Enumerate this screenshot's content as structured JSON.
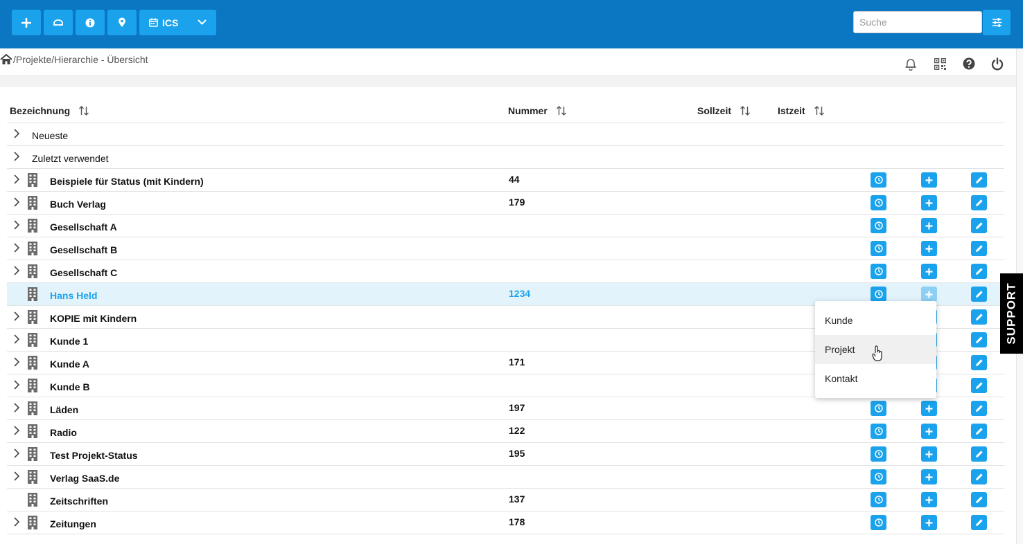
{
  "topbar": {
    "buttons": [
      {
        "name": "add-button",
        "icon": "plus-icon"
      },
      {
        "name": "vehicle-button",
        "icon": "car-icon"
      },
      {
        "name": "info-button",
        "icon": "info-icon"
      },
      {
        "name": "location-button",
        "icon": "map-pin-icon"
      }
    ],
    "ics_label": "ICS",
    "search_placeholder": "Suche",
    "accent_color": "#1aa3ec",
    "bar_color": "#0b77c2"
  },
  "breadcrumb": "/Projekte/Hierarchie - Übersicht",
  "header_icons": [
    "bell-icon",
    "qr-code-icon",
    "help-icon",
    "power-icon"
  ],
  "table": {
    "columns": {
      "bezeichnung": "Bezeichnung",
      "nummer": "Nummer",
      "sollzeit": "Sollzeit",
      "istzeit": "Istzeit"
    },
    "rows": [
      {
        "name": "Neueste",
        "number": "",
        "kind": "group",
        "expandable": true
      },
      {
        "name": "Zuletzt verwendet",
        "number": "",
        "kind": "group",
        "expandable": true
      },
      {
        "name": "Beispiele für Status (mit Kindern)",
        "number": "44",
        "kind": "item",
        "expandable": true
      },
      {
        "name": "Buch Verlag",
        "number": "179",
        "kind": "item",
        "expandable": true
      },
      {
        "name": "Gesellschaft A",
        "number": "",
        "kind": "item",
        "expandable": true
      },
      {
        "name": "Gesellschaft B",
        "number": "",
        "kind": "item",
        "expandable": true
      },
      {
        "name": "Gesellschaft C",
        "number": "",
        "kind": "item",
        "expandable": true
      },
      {
        "name": "Hans Held",
        "number": "1234",
        "kind": "item",
        "expandable": false,
        "highlighted": true
      },
      {
        "name": "KOPIE mit Kindern",
        "number": "",
        "kind": "item",
        "expandable": true
      },
      {
        "name": "Kunde 1",
        "number": "",
        "kind": "item",
        "expandable": true
      },
      {
        "name": "Kunde A",
        "number": "171",
        "kind": "item",
        "expandable": true
      },
      {
        "name": "Kunde B",
        "number": "",
        "kind": "item",
        "expandable": true
      },
      {
        "name": "Läden",
        "number": "197",
        "kind": "item",
        "expandable": true
      },
      {
        "name": "Radio",
        "number": "122",
        "kind": "item",
        "expandable": true
      },
      {
        "name": "Test Projekt-Status",
        "number": "195",
        "kind": "item",
        "expandable": true
      },
      {
        "name": "Verlag SaaS.de",
        "number": "",
        "kind": "item",
        "expandable": true
      },
      {
        "name": "Zeitschriften",
        "number": "137",
        "kind": "item",
        "expandable": false
      },
      {
        "name": "Zeitungen",
        "number": "178",
        "kind": "item",
        "expandable": true
      }
    ]
  },
  "dropdown": {
    "items": [
      "Kunde",
      "Projekt",
      "Kontakt"
    ],
    "active_index": 1
  },
  "support_tab": "SUPPORT"
}
